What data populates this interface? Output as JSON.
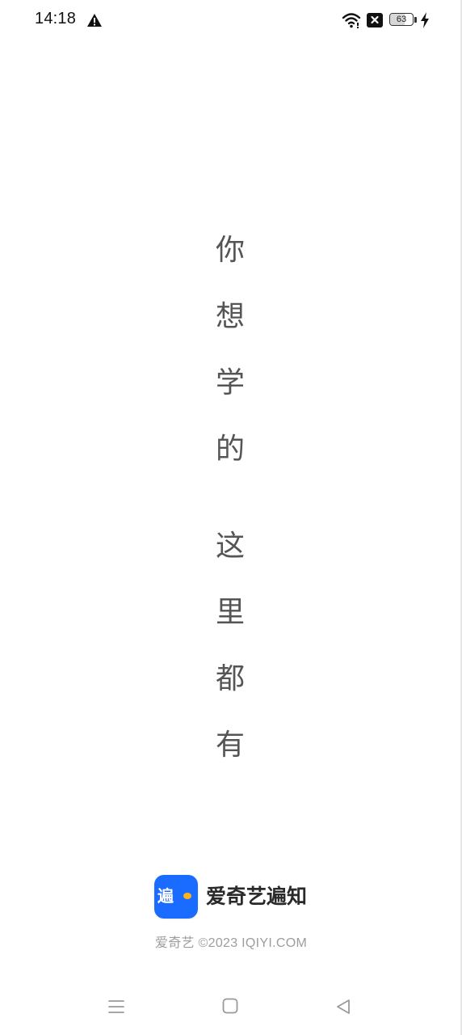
{
  "status_bar": {
    "time": "14:18",
    "battery_level": "63",
    "battery_fraction": 0.63,
    "icons": [
      "warning-icon",
      "wifi-icon",
      "close-box-icon",
      "battery-icon",
      "charging-bolt-icon"
    ]
  },
  "slogan": {
    "line1": [
      "你",
      "想",
      "学",
      "的"
    ],
    "line2": [
      "这",
      "里",
      "都",
      "有"
    ]
  },
  "brand": {
    "logo_text": "遍",
    "name": "爱奇艺遍知",
    "logo_color": "#1a6bff",
    "logo_accent": "#ffb11a"
  },
  "footer": {
    "copyright": "爱奇艺 ©2023 IQIYI.COM"
  },
  "nav_bar": {
    "icons": [
      "menu-icon",
      "home-icon",
      "back-icon"
    ]
  }
}
